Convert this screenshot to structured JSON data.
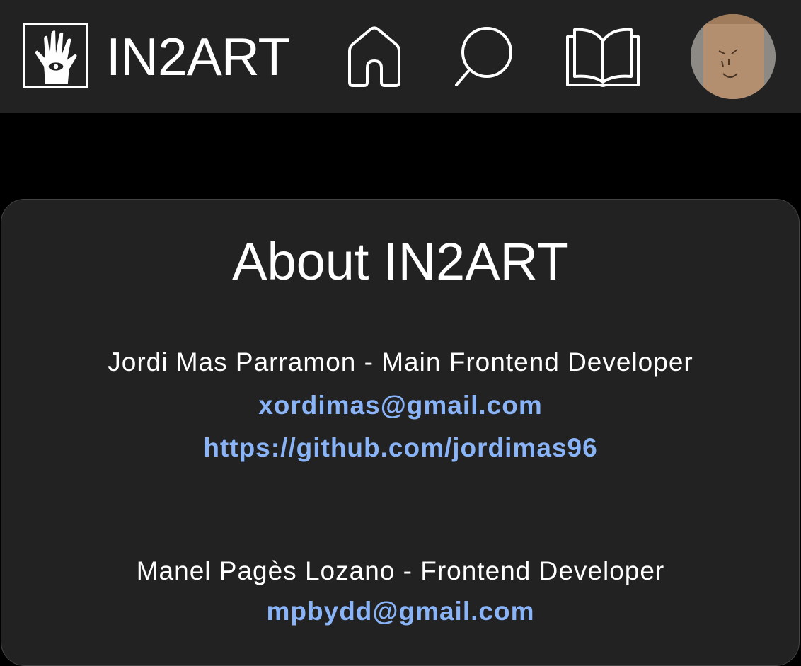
{
  "navbar": {
    "brand": "IN2ART",
    "logo_icon": "hand-eye-icon",
    "icons": [
      "home-icon",
      "search-icon",
      "book-icon"
    ],
    "avatar": "user-avatar"
  },
  "about": {
    "title": "About IN2ART",
    "people": [
      {
        "name_role": "Jordi Mas Parramon - Main Frontend Developer",
        "email": "xordimas@gmail.com",
        "github": "https://github.com/jordimas96"
      },
      {
        "name_role": "Manel Pagès Lozano - Frontend Developer",
        "email": "mpbydd@gmail.com"
      }
    ]
  },
  "colors": {
    "navbar_bg": "#222222",
    "page_bg": "#000000",
    "card_bg": "#222222",
    "link": "#8ab4f8",
    "text": "#ffffff"
  }
}
